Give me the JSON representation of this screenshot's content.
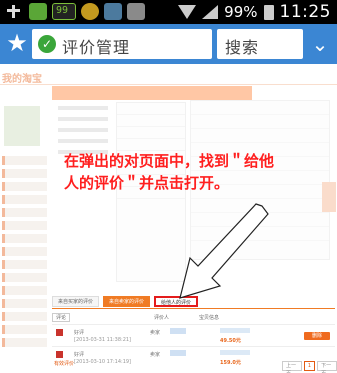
{
  "status_bar": {
    "battery_percent": "99%",
    "time": "11:25"
  },
  "browser": {
    "url_title": "评价管理",
    "search_label": "搜索"
  },
  "page": {
    "logo_text": "我的淘宝",
    "tabs": [
      "来自买家的评价",
      "来自卖家的评价",
      "给他人的评价"
    ],
    "active_tab_index": 1,
    "highlighted_tab_index": 2,
    "table_headers": {
      "filter": "评论",
      "col_rater": "评价人",
      "col_info": "宝贝信息"
    },
    "rows": [
      {
        "who": "好评",
        "date": "[2013-03-31 11:38:21]",
        "role": "卖家",
        "price": "49.50元",
        "button": "删除"
      },
      {
        "who": "好评",
        "date": "[2013-03-10 17:14:19]",
        "role": "卖家",
        "price": "159.0元",
        "tag": "有效评价"
      }
    ],
    "pager": [
      "上一页",
      "1",
      "下一页"
    ],
    "pager_current_index": 1
  },
  "annotation": {
    "instruction": "在弹出的对页面中，找到＂给他人的评价＂并点击打开。",
    "color": "#ff1f1f"
  }
}
